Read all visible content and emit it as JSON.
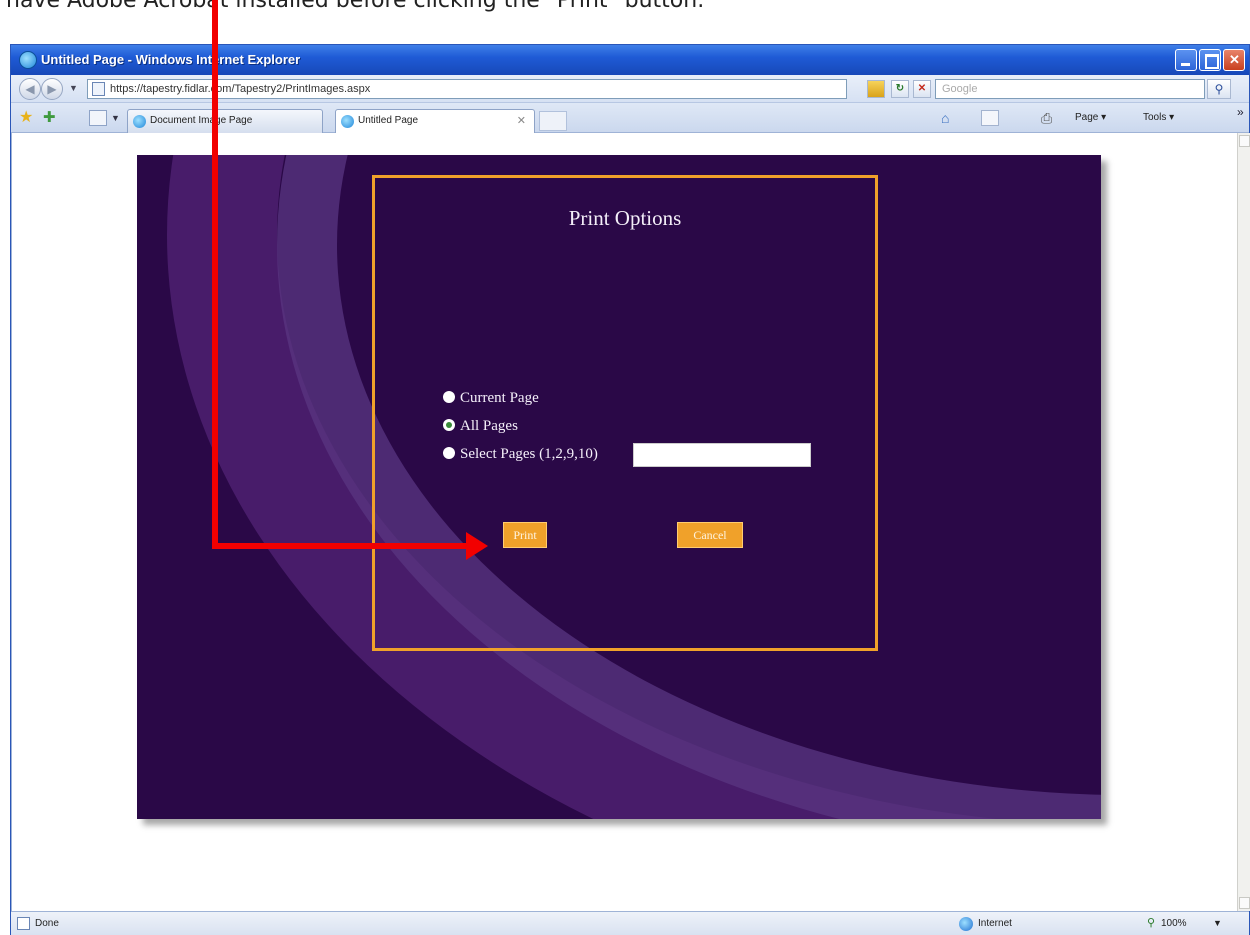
{
  "instruction": "have Adobe Acrobat installed before clicking the \"Print\" button.",
  "window": {
    "title": "Untitled Page - Windows Internet Explorer"
  },
  "address": {
    "url": "https://tapestry.fidlar.com/Tapestry2/PrintImages.aspx",
    "search_placeholder": "Google"
  },
  "tabs": [
    {
      "label": "Document Image Page"
    },
    {
      "label": "Untitled Page"
    }
  ],
  "commands": {
    "page": "Page ▾",
    "tools": "Tools ▾"
  },
  "print_options": {
    "title": "Print Options",
    "options": [
      {
        "label": "Current Page",
        "checked": false
      },
      {
        "label": "All Pages",
        "checked": true
      },
      {
        "label": "Select Pages (1,2,9,10)",
        "checked": false
      }
    ],
    "pages_value": "",
    "print_label": "Print",
    "cancel_label": "Cancel"
  },
  "status": {
    "text": "Done",
    "zone": "Internet",
    "zoom": "100%"
  },
  "colors": {
    "panel": "#2a0847",
    "accent": "#f0a12a",
    "arrow": "#f20000"
  }
}
